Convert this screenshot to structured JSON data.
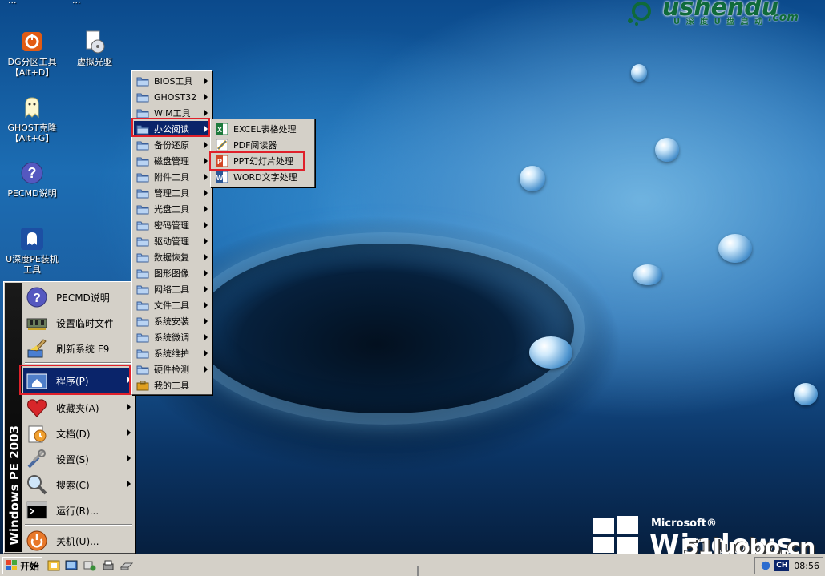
{
  "brand": {
    "name": "ushendu",
    "tagline": "U 深 度 U 盘 启 动",
    "domain": ".com"
  },
  "desktop": {
    "top_cut_labels": [
      "...",
      "..."
    ],
    "icons": [
      {
        "name": "dg-partition",
        "label": "DG分区工具",
        "label2": "【Alt+D】"
      },
      {
        "name": "virtual-cdrom",
        "label": "虚拟光驱",
        "label2": ""
      },
      {
        "name": "ghost-clone",
        "label": "GHOST克隆",
        "label2": "【Alt+G】"
      },
      {
        "name": "pecmd-help",
        "label": "PECMD说明",
        "label2": ""
      },
      {
        "name": "ushendu-installer",
        "label": "U深度PE装机",
        "label2": "工具"
      }
    ]
  },
  "start_menu": {
    "band_text": "Windows PE 2003",
    "items": [
      {
        "label": "PECMD说明",
        "icon": "help-icon",
        "has_arrow": false
      },
      {
        "label": "设置临时文件",
        "icon": "memory-icon",
        "has_arrow": false
      },
      {
        "label": "刷新系统 F9",
        "icon": "broom-icon",
        "has_arrow": false
      },
      {
        "label": "程序(P)",
        "icon": "programs-icon",
        "has_arrow": true
      },
      {
        "label": "收藏夹(A)",
        "icon": "favorites-icon",
        "has_arrow": true
      },
      {
        "label": "文档(D)",
        "icon": "documents-icon",
        "has_arrow": true
      },
      {
        "label": "设置(S)",
        "icon": "settings-icon",
        "has_arrow": true
      },
      {
        "label": "搜索(C)",
        "icon": "search-icon",
        "has_arrow": true
      },
      {
        "label": "运行(R)...",
        "icon": "run-icon",
        "has_arrow": false
      },
      {
        "label": "关机(U)...",
        "icon": "shutdown-icon",
        "has_arrow": false
      }
    ]
  },
  "programs_menu": {
    "items": [
      {
        "label": "BIOS工具",
        "has_arrow": true
      },
      {
        "label": "GHOST32",
        "has_arrow": true
      },
      {
        "label": "WIM工具",
        "has_arrow": true
      },
      {
        "label": "办公阅读",
        "has_arrow": true
      },
      {
        "label": "备份还原",
        "has_arrow": true
      },
      {
        "label": "磁盘管理",
        "has_arrow": true
      },
      {
        "label": "附件工具",
        "has_arrow": true
      },
      {
        "label": "管理工具",
        "has_arrow": true
      },
      {
        "label": "光盘工具",
        "has_arrow": true
      },
      {
        "label": "密码管理",
        "has_arrow": true
      },
      {
        "label": "驱动管理",
        "has_arrow": true
      },
      {
        "label": "数据恢复",
        "has_arrow": true
      },
      {
        "label": "图形图像",
        "has_arrow": true
      },
      {
        "label": "网络工具",
        "has_arrow": true
      },
      {
        "label": "文件工具",
        "has_arrow": true
      },
      {
        "label": "系统安装",
        "has_arrow": true
      },
      {
        "label": "系统微调",
        "has_arrow": true
      },
      {
        "label": "系统维护",
        "has_arrow": true
      },
      {
        "label": "硬件检测",
        "has_arrow": true
      },
      {
        "label": "我的工具",
        "has_arrow": false
      }
    ]
  },
  "office_menu": {
    "items": [
      {
        "label": "EXCEL表格处理",
        "icon": "excel-icon"
      },
      {
        "label": "PDF阅读器",
        "icon": "pdf-icon"
      },
      {
        "label": "PPT幻灯片处理",
        "icon": "ppt-icon"
      },
      {
        "label": "WORD文字处理",
        "icon": "word-icon"
      }
    ]
  },
  "wallpaper": {
    "logo_microsoft": "Microsoft®",
    "logo_product": "Windows PE",
    "watermark": "51luobo.cn"
  },
  "taskbar": {
    "start_label": "开始",
    "tray_lang": "CH",
    "clock": "08:56"
  },
  "colors": {
    "menu_bg": "#d4d0c8",
    "selection": "#0a246a",
    "highlight_box": "#e0202a"
  }
}
